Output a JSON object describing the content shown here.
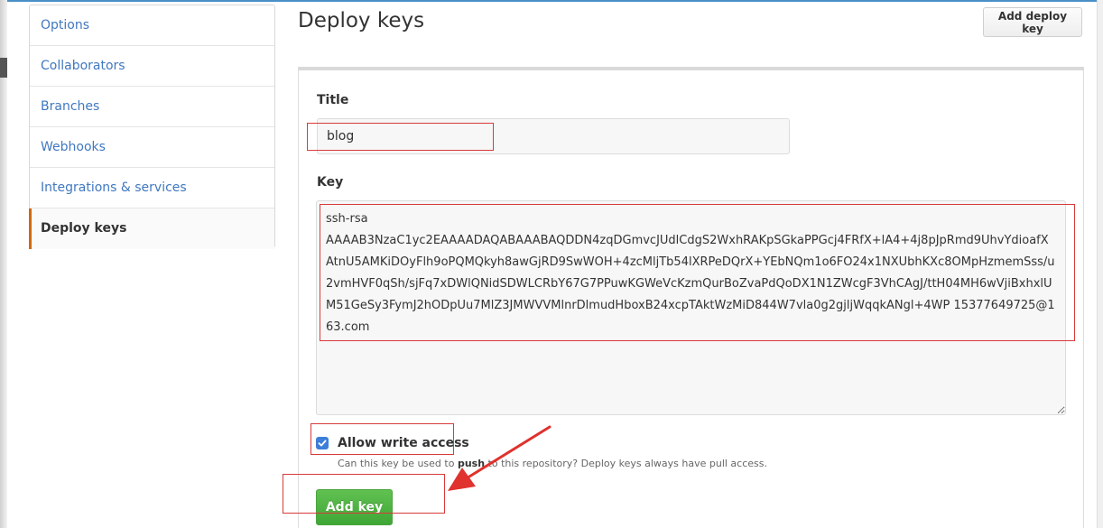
{
  "sidebar": {
    "items": [
      {
        "label": "Options",
        "selected": false
      },
      {
        "label": "Collaborators",
        "selected": false
      },
      {
        "label": "Branches",
        "selected": false
      },
      {
        "label": "Webhooks",
        "selected": false
      },
      {
        "label": "Integrations & services",
        "selected": false
      },
      {
        "label": "Deploy keys",
        "selected": true
      }
    ]
  },
  "header": {
    "title": "Deploy keys",
    "add_button_label": "Add deploy key"
  },
  "form": {
    "title_label": "Title",
    "title_value": "blog",
    "key_label": "Key",
    "key_value": "ssh-rsa\nAAAAB3NzaC1yc2EAAAADAQABAAABAQDDN4zqDGmvcJUdlCdgS2WxhRAKpSGkaPPGcj4FRfX+lA4+4j8pJpRmd9UhvYdioafXAtnU5AMKiDOyFlh9oPQMQkyh8awGjRD9SwWOH+4zcMljTb54lXRPeDQrX+YEbNQm1o6FO24x1NXUbhKXc8OMpHzmemSss/u2vmHVF0qSh/sjFq7xDWlQNidSDWLCRbY67G7PPuwKGWeVcKzmQurBoZvaPdQoDX1N1ZWcgF3VhCAgJ/ttH04MH6wVjiBxhxlUM51GeSy3FymJ2hODpUu7MlZ3JMWVVMlnrDlmudHboxB24xcpTAktWzMiD844W7vla0g2gjljWqqkANgl+4WP 15377649725@163.com",
    "allow_write_label": "Allow write access",
    "allow_write_checked": true,
    "note_prefix": "Can this key be used to",
    "note_bold": "push",
    "note_suffix": "to this repository? Deploy keys always have pull access.",
    "submit_label": "Add key"
  },
  "annotation_color": "#d83b3b",
  "accent_color": "#4078c0",
  "success_color": "#4cb043"
}
